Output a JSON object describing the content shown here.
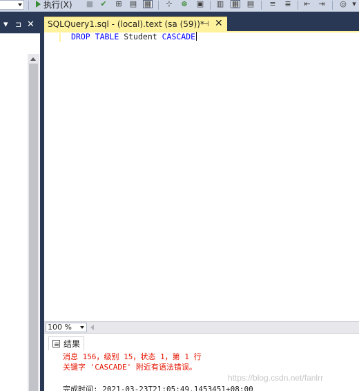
{
  "toolbar": {
    "execute_label": "执行(X)",
    "icons": [
      "play-icon",
      "stop-icon",
      "check-icon",
      "parse-icon",
      "display-plan-icon",
      "results-to-icon",
      "query-options-icon",
      "intellisense-icon",
      "comment-icon",
      "indent-icon",
      "specify-values-icon"
    ]
  },
  "left_panel": {
    "dropdown_glyph": "▾",
    "pin_glyph": "⊐",
    "close_glyph": "✕"
  },
  "document_tab": {
    "title": "SQLQuery1.sql - (local).text (sa (59))*",
    "pin_glyph": "⊣",
    "close_glyph": "✕"
  },
  "editor": {
    "code_keyword_1": "DROP",
    "code_keyword_2": "TABLE",
    "code_identifier": "Student",
    "code_keyword_3": "CASCADE"
  },
  "zoom": {
    "value": "100 %"
  },
  "results": {
    "tab_label": "结果",
    "message_line_1": "消息 156，级别 15，状态 1，第 1 行",
    "message_line_2": "关键字 'CASCADE' 附近有语法错误。",
    "completion_line": "完成时间: 2021-03-23T21:05:49.1453451+08:00"
  },
  "watermark": "https://blog.csdn.net/fanlrr",
  "colors": {
    "chrome": "#293955",
    "tab_active": "#fff29d",
    "keyword": "#0000ff",
    "error": "#e51400"
  }
}
